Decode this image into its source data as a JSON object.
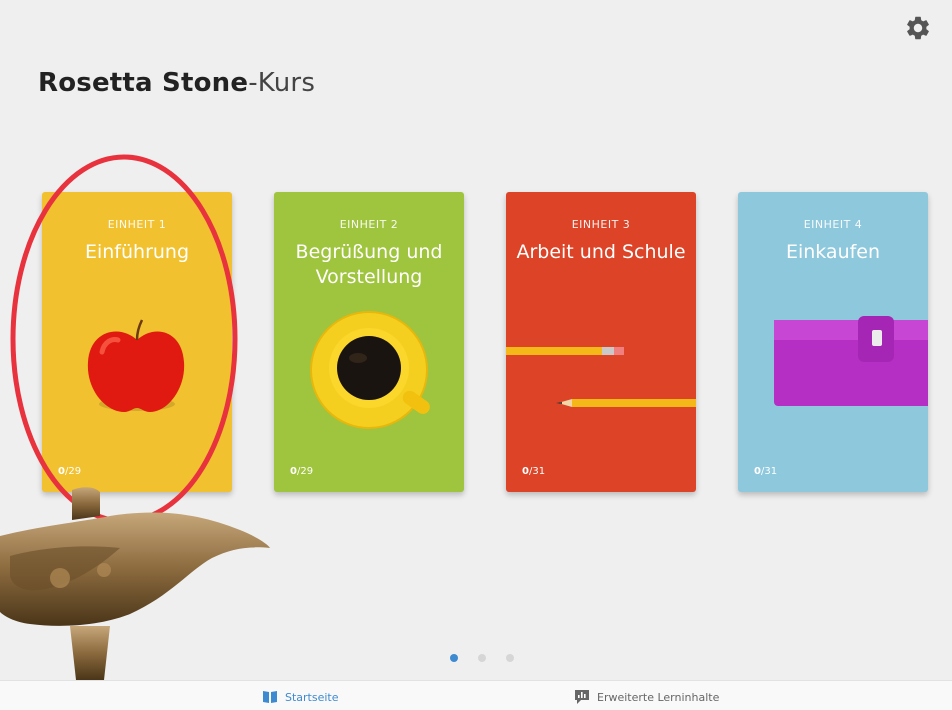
{
  "header": {
    "brand": "Rosetta Stone",
    "suffix": "-Kurs",
    "settings_icon": "gear-icon"
  },
  "units": [
    {
      "label": "EINHEIT 1",
      "name": "Einführung",
      "progress_done": "0",
      "progress_total": "/29",
      "color": "#f2c12f",
      "image": "apple"
    },
    {
      "label": "EINHEIT 2",
      "name": "Begrüßung und Vorstellung",
      "progress_done": "0",
      "progress_total": "/29",
      "color": "#9fc43d",
      "image": "coffee-cup"
    },
    {
      "label": "EINHEIT 3",
      "name": "Arbeit und Schule",
      "progress_done": "0",
      "progress_total": "/31",
      "color": "#dc4327",
      "image": "pencils"
    },
    {
      "label": "EINHEIT 4",
      "name": "Einkaufen",
      "progress_done": "0",
      "progress_total": "/31",
      "color": "#8ec8dc",
      "image": "wallet"
    }
  ],
  "pagination": {
    "pages": 3,
    "active": 1
  },
  "bottom_nav": {
    "home_label": "Startseite",
    "home_icon": "book-icon",
    "more_label": "Erweiterte Lerninhalte",
    "more_icon": "chart-bubble-icon",
    "accent": "#3e8ad0"
  },
  "overlay": {
    "circle_color": "#e8323d",
    "lamp": "genie-lamp"
  }
}
